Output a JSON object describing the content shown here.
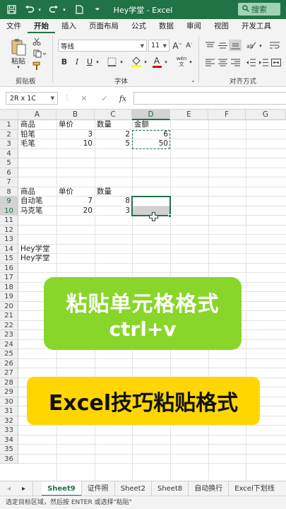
{
  "titlebar": {
    "title": "Hey学堂  -  Excel",
    "search_label": "搜索",
    "icons": [
      "save-icon",
      "undo-icon",
      "redo-icon",
      "new-document-icon",
      "customize-icon"
    ]
  },
  "tabs": [
    "文件",
    "开始",
    "插入",
    "页面布局",
    "公式",
    "数据",
    "审阅",
    "视图",
    "开发工具"
  ],
  "ribbon": {
    "paste_label": "粘贴",
    "clipboard_label": "剪贴板",
    "font_label": "字体",
    "align_label": "对齐方式",
    "font_name": "等线",
    "font_size": "11",
    "bold": "B",
    "italic": "I",
    "underline": "U",
    "grow_font": "A",
    "shrink_font": "A",
    "font_color": "A",
    "wen": "wén"
  },
  "formula_bar": {
    "name_box": "2R x 1C",
    "fx": "fx",
    "cancel": "✕",
    "confirm": "✓",
    "formula": ""
  },
  "columns": [
    "A",
    "B",
    "C",
    "D",
    "E",
    "F",
    "G"
  ],
  "rows": [
    "1",
    "2",
    "3",
    "4",
    "5",
    "6",
    "7",
    "8",
    "9",
    "10",
    "11",
    "12",
    "13",
    "14",
    "15",
    "16",
    "17",
    "18",
    "19",
    "20",
    "21",
    "22",
    "23",
    "24",
    "25",
    "26",
    "27",
    "28",
    "29",
    "30",
    "31",
    "32",
    "33",
    "34",
    "35",
    "36"
  ],
  "cells": {
    "r1": {
      "a": "商品",
      "b": "单价",
      "c": "数量",
      "d": "金额"
    },
    "r2": {
      "a": "铅笔",
      "b": "3",
      "c": "2",
      "d": "6"
    },
    "r3": {
      "a": "毛笔",
      "b": "10",
      "c": "5",
      "d": "50"
    },
    "r8": {
      "a": "商品",
      "b": "单价",
      "c": "数量"
    },
    "r9": {
      "a": "自动笔",
      "b": "7",
      "c": "8"
    },
    "r10": {
      "a": "马克笔",
      "b": "20",
      "c": "3"
    },
    "r14": {
      "a": "Hey学堂"
    },
    "r15": {
      "a": "Hey学堂"
    }
  },
  "overlays": {
    "green_line1": "粘贴单元格格式",
    "green_line2": "ctrl+v",
    "yellow": "Excel技巧粘贴格式"
  },
  "sheets": [
    "Sheet9",
    "证件照",
    "Sheet2",
    "Sheet8",
    "自动换行",
    "Excel下划线"
  ],
  "active_sheet": "Sheet9",
  "status_text": "选定目标区域，然后按 ENTER 或选择\"粘贴\"",
  "colors": {
    "excel_green": "#217346",
    "green_overlay": "#88d62a",
    "yellow_overlay": "#ffd600"
  }
}
